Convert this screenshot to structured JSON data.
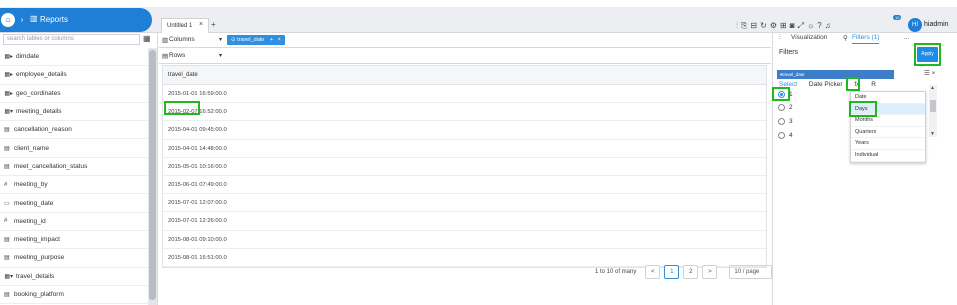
{
  "header": {
    "breadcrumb_home_icon": "home-icon",
    "breadcrumb_label": "Reports",
    "tab_label": "Untitled 1",
    "tab_close": "×",
    "tab_add": "+",
    "notification_count": "10",
    "user_initials": "HI",
    "user_name": "hiadmin"
  },
  "left_panel": {
    "search_placeholder": "search tables or columns",
    "items": [
      {
        "label": "dimdate",
        "icon": "table-icon",
        "expander": "▸",
        "level": 0
      },
      {
        "label": "employee_details",
        "icon": "table-icon",
        "expander": "▸",
        "level": 0
      },
      {
        "label": "geo_cordinates",
        "icon": "table-icon",
        "expander": "▸",
        "level": 0
      },
      {
        "label": "meeting_details",
        "icon": "table-icon",
        "expander": "▾",
        "level": 0
      },
      {
        "label": "cancellation_reason",
        "icon": "text-field-icon",
        "level": 1
      },
      {
        "label": "client_name",
        "icon": "text-field-icon",
        "level": 1
      },
      {
        "label": "meet_cancellation_status",
        "icon": "text-field-icon",
        "level": 1
      },
      {
        "label": "meeting_by",
        "icon": "number-field-icon",
        "level": 1
      },
      {
        "label": "meeting_date",
        "icon": "date-field-icon",
        "level": 1
      },
      {
        "label": "meeting_id",
        "icon": "number-field-icon",
        "level": 1
      },
      {
        "label": "meeting_impact",
        "icon": "text-field-icon",
        "level": 1
      },
      {
        "label": "meeting_purpose",
        "icon": "text-field-icon",
        "level": 1
      },
      {
        "label": "travel_details",
        "icon": "table-icon",
        "expander": "▾",
        "level": 0
      },
      {
        "label": "booking_platform",
        "icon": "text-field-icon",
        "level": 1
      }
    ]
  },
  "shelves": {
    "columns_label": "Columns",
    "rows_label": "Rows",
    "column_pill": "travel_date",
    "pill_add": "+",
    "pill_close": "×"
  },
  "table": {
    "header": "travel_date",
    "rows": [
      "2015-01-01 16:59:00.0",
      "2015-02-07 16:52:00.0",
      "2015-04-01 09:45:00.0",
      "2015-04-01 14:48:00.0",
      "2015-05-01 10:16:00.0",
      "2015-06-01 07:49:00.0",
      "2015-07-01 12:07:00.0",
      "2015-07-01 12:26:00.0",
      "2015-08-01 09:10:00.0",
      "2015-08-01 16:51:00.0"
    ]
  },
  "pagination": {
    "summary": "1 to 10 of many",
    "prev": "<",
    "page1": "1",
    "page2": "2",
    "next": ">",
    "per_page": "10 / page"
  },
  "right_panel": {
    "tab_visualization": "Visualization",
    "tab_filters": "Filters (1)",
    "more": "...",
    "filters_title": "Filters",
    "apply_label": "Apply",
    "filter_field": "travel_date",
    "filter_modes": [
      "Select",
      "Date Picker",
      "fx",
      "R"
    ],
    "radio_options": [
      "1",
      "2",
      "3",
      "4"
    ],
    "granularity_options": [
      "Date",
      "Days",
      "Months",
      "Quarters",
      "Years",
      "Individual"
    ],
    "hovered_option": "Days"
  }
}
